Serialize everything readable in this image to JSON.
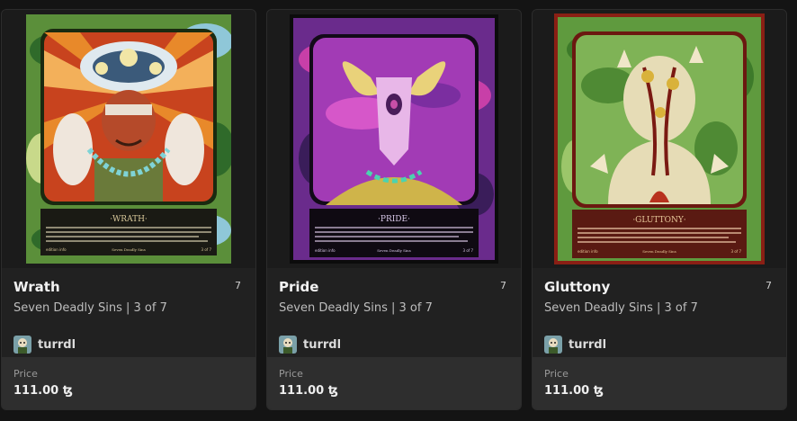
{
  "cards": [
    {
      "title": "Wrath",
      "count": "7",
      "subtitle": "Seven Deadly Sins | 3 of 7",
      "creator": "turrdl",
      "price_label": "Price",
      "price_value": "111.00 ꜩ",
      "art": {
        "panel_title": "·WRATH·",
        "footer_left": "edition info",
        "footer_center": "Seven Deadly Sins",
        "footer_right": "3 of 7",
        "bg": "#5b8f3a",
        "border": "#3a6b28",
        "frame": "#1a2a10",
        "inner": "#c8431e"
      }
    },
    {
      "title": "Pride",
      "count": "7",
      "subtitle": "Seven Deadly Sins | 3 of 7",
      "creator": "turrdl",
      "price_label": "Price",
      "price_value": "111.00 ꜩ",
      "art": {
        "panel_title": "·PRIDE·",
        "footer_left": "edition info",
        "footer_center": "Seven Deadly Sins",
        "footer_right": "3 of 7",
        "bg": "#6a2b8c",
        "border": "#0c0c0c",
        "frame": "#120a18",
        "inner": "#a23bb5"
      }
    },
    {
      "title": "Gluttony",
      "count": "7",
      "subtitle": "Seven Deadly Sins | 3 of 7",
      "creator": "turrdl",
      "price_label": "Price",
      "price_value": "111.00 ꜩ",
      "art": {
        "panel_title": "·GLUTTONY·",
        "footer_left": "edition info",
        "footer_center": "Seven Deadly Sins",
        "footer_right": "3 of 7",
        "bg": "#5f9a3e",
        "border": "#8a1f14",
        "frame": "#6b1810",
        "inner": "#7fb356"
      }
    }
  ]
}
